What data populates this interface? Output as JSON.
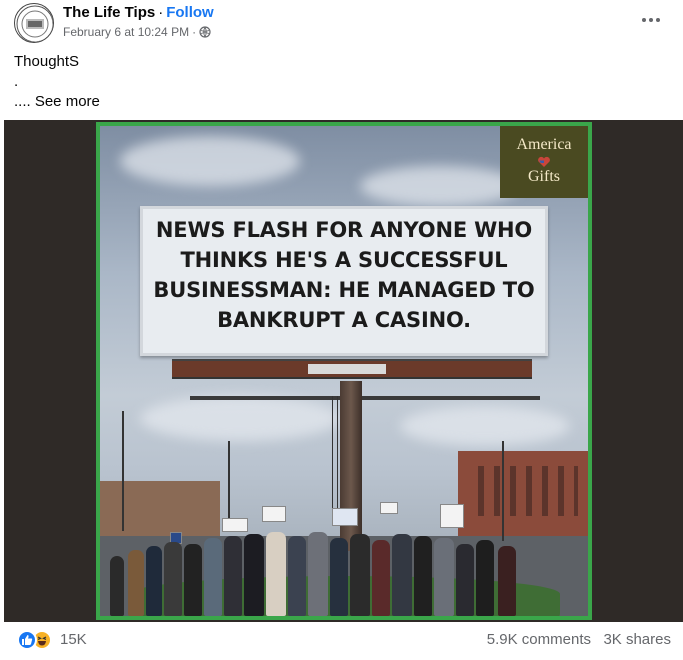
{
  "post": {
    "author": "The Life Tips",
    "separator": "·",
    "follow_label": "Follow",
    "timestamp": "February 6 at 10:24 PM",
    "meta_separator": "·",
    "privacy_icon": "globe-icon",
    "more_icon": "more-dots-icon",
    "text_lines": [
      "ThoughtS",
      "."
    ],
    "see_more_label": ".... See more"
  },
  "media": {
    "billboard_text": "NEWS FLASH FOR ANYONE WHO THINKS HE'S A SUCCESSFUL BUSINESSMAN: HE MANAGED TO BANKRUPT A CASINO.",
    "badge_line1": "America",
    "badge_line2": "Gifts",
    "frame_color": "#3aa64a"
  },
  "reactions": {
    "icons": [
      "like-icon",
      "haha-icon"
    ],
    "count": "15K",
    "comments": "5.9K comments",
    "shares": "3K shares"
  },
  "colors": {
    "link": "#1877f2",
    "secondary_text": "#65676b",
    "like": "#1877f2",
    "haha": "#f7b125"
  }
}
